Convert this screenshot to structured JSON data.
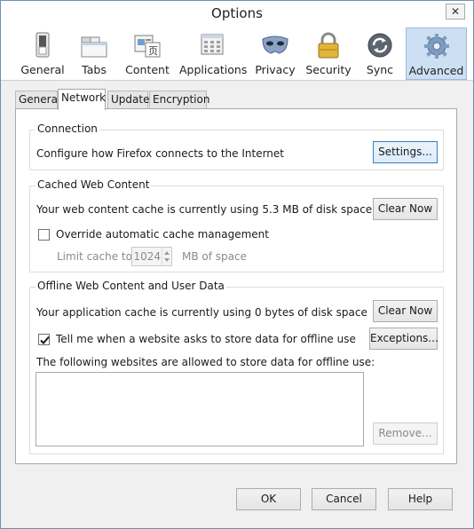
{
  "window": {
    "title": "Options",
    "close_glyph": "✕"
  },
  "toolbar": {
    "items": [
      {
        "label": "General",
        "icon": "switch-icon"
      },
      {
        "label": "Tabs",
        "icon": "tabs-icon"
      },
      {
        "label": "Content",
        "icon": "content-icon"
      },
      {
        "label": "Applications",
        "icon": "applications-icon"
      },
      {
        "label": "Privacy",
        "icon": "mask-icon"
      },
      {
        "label": "Security",
        "icon": "padlock-icon"
      },
      {
        "label": "Sync",
        "icon": "sync-icon"
      },
      {
        "label": "Advanced",
        "icon": "gear-icon"
      }
    ],
    "active": "Advanced"
  },
  "tabs": {
    "items": [
      "General",
      "Network",
      "Update",
      "Encryption"
    ],
    "active": "Network"
  },
  "connection": {
    "title": "Connection",
    "description": "Configure how Firefox connects to the Internet",
    "settings_label": "Settings..."
  },
  "cache": {
    "title": "Cached Web Content",
    "description": "Your web content cache is currently using 5.3 MB of disk space",
    "clear_label": "Clear Now",
    "override_label": "Override automatic cache management",
    "override_checked": false,
    "limit_label": "Limit cache to",
    "limit_value": "1024",
    "limit_unit": "MB of space"
  },
  "offline": {
    "title": "Offline Web Content and User Data",
    "description": "Your application cache is currently using 0 bytes of disk space",
    "clear_label": "Clear Now",
    "tell_label": "Tell me when a website asks to store data for offline use",
    "tell_checked": true,
    "exceptions_label": "Exceptions...",
    "allowed_label": "The following websites are allowed to store data for offline use:",
    "remove_label": "Remove..."
  },
  "dialog": {
    "ok_label": "OK",
    "cancel_label": "Cancel",
    "help_label": "Help"
  }
}
